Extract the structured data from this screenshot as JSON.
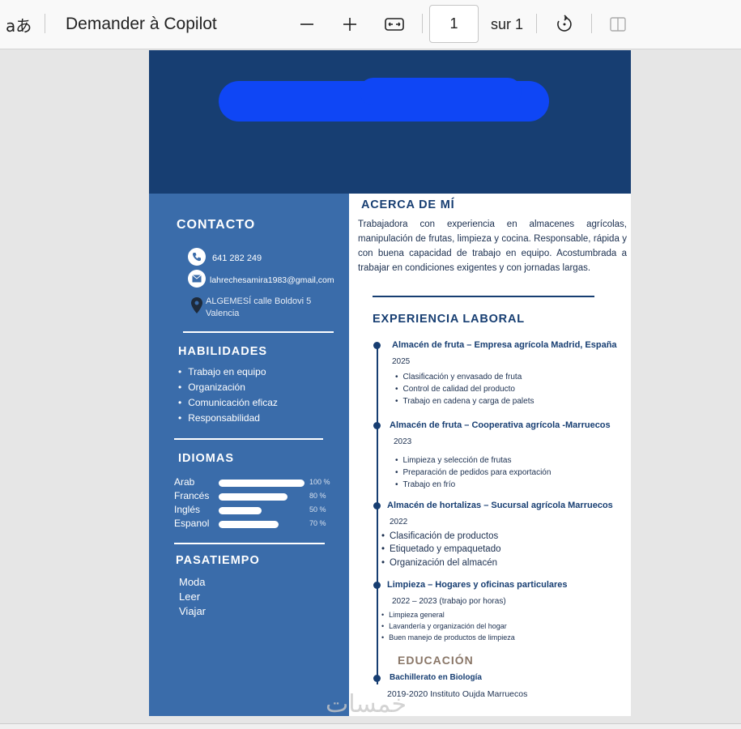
{
  "toolbar": {
    "translate_glyph": "aあ",
    "copilot_label": "Demander à Copilot",
    "page_value": "1",
    "page_total": "sur 1"
  },
  "sidebar": {
    "contact_title": "CONTACTO",
    "phone": "641 282 249",
    "email": "lahrechesamira1983@gmail,com",
    "address_line1": "ALGEMESÍ calle Boldovi 5",
    "address_line2": "Valencia",
    "skills_title": "HABILIDADES",
    "skills": [
      "Trabajo en equipo",
      "Organización",
      "Comunicación eficaz",
      "Responsabilidad"
    ],
    "languages_title": "IDIOMAS",
    "languages": [
      {
        "name": "Arab",
        "level": 100,
        "pct": "100 %"
      },
      {
        "name": "Francés",
        "level": 80,
        "pct": "80 %"
      },
      {
        "name": "Inglés",
        "level": 50,
        "pct": "50 %"
      },
      {
        "name": "Espanol",
        "level": 70,
        "pct": "70 %"
      }
    ],
    "hobbies_title": "PASATIEMPO",
    "hobbies": [
      "Moda",
      "Leer",
      "Viajar"
    ]
  },
  "main": {
    "about_title": "ACERCA DE MÍ",
    "about_text": "Trabajadora con experiencia en almacenes agrícolas, manipulación de frutas, limpieza y cocina. Responsable, rápida y con buena capacidad de trabajo en equipo. Acostumbrada a trabajar en condiciones exigentes y con jornadas largas.",
    "experience_title": "EXPERIENCIA LABORAL",
    "jobs": [
      {
        "title": "Almacén de fruta – Empresa agrícola Madrid, España",
        "year": "2025",
        "bullets": [
          "Clasificación y envasado de fruta",
          "Control de calidad del producto",
          "Trabajo en cadena y carga de palets"
        ]
      },
      {
        "title": "Almacén de fruta – Cooperativa agrícola -Marruecos",
        "year": "2023",
        "bullets": [
          "Limpieza y selección de frutas",
          "Preparación de pedidos para exportación",
          "Trabajo en frío"
        ]
      },
      {
        "title": "Almacén de hortalizas – Sucursal agrícola Marruecos",
        "year": "2022",
        "bullets": [
          "Clasificación de productos",
          "Etiquetado y empaquetado",
          "Organización del almacén"
        ]
      },
      {
        "title": "Limpieza – Hogares y oficinas particulares",
        "year": "2022 – 2023 (trabajo por horas)",
        "bullets": [
          "Limpieza general",
          "Lavandería y organización del hogar",
          "Buen manejo de productos de limpieza"
        ]
      }
    ],
    "education_title": "EDUCACIÓN",
    "education_degree": "Bachillerato en Biología",
    "education_detail": "2019-2020  Instituto Oujda Marruecos"
  },
  "watermark": "خمسات",
  "colors": {
    "banner": "#173e72",
    "sidebar": "#3a6caa",
    "redaction": "#0f46f5",
    "heading": "#173e72"
  }
}
